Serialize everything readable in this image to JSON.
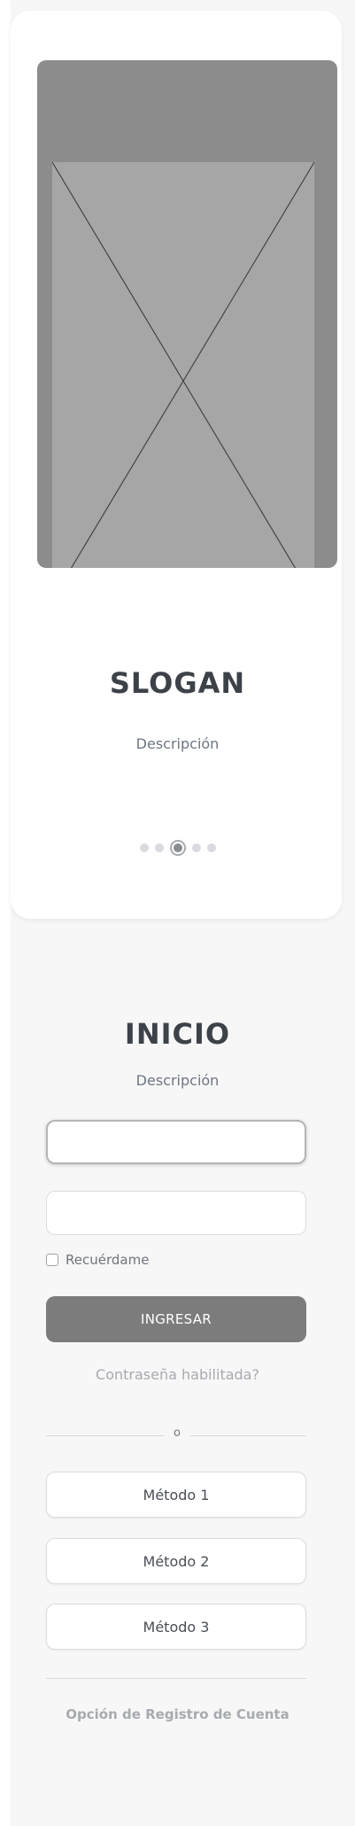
{
  "hero": {
    "slogan": "SLOGAN",
    "description": "Descripción",
    "carousel": {
      "total": 5,
      "active_index": 3
    }
  },
  "login": {
    "title": "INICIO",
    "description": "Descripción",
    "username_value": "",
    "password_value": "",
    "remember_label": "Recuérdame",
    "remember_checked": false,
    "submit_label": "INGRESAR",
    "forgot_label": "Contraseña habilitada?",
    "divider_text": "o",
    "methods": [
      "Método 1",
      "Método 2",
      "Método 3"
    ],
    "register_label": "Opción de Registro de Cuenta"
  },
  "colors": {
    "primary_button": "#7c7c7c",
    "heading_text": "#3d4249",
    "muted_text": "#a7aaaf",
    "image_placeholder": "#a6a6a6"
  },
  "icons": {
    "image_placeholder": "image-placeholder-icon"
  }
}
